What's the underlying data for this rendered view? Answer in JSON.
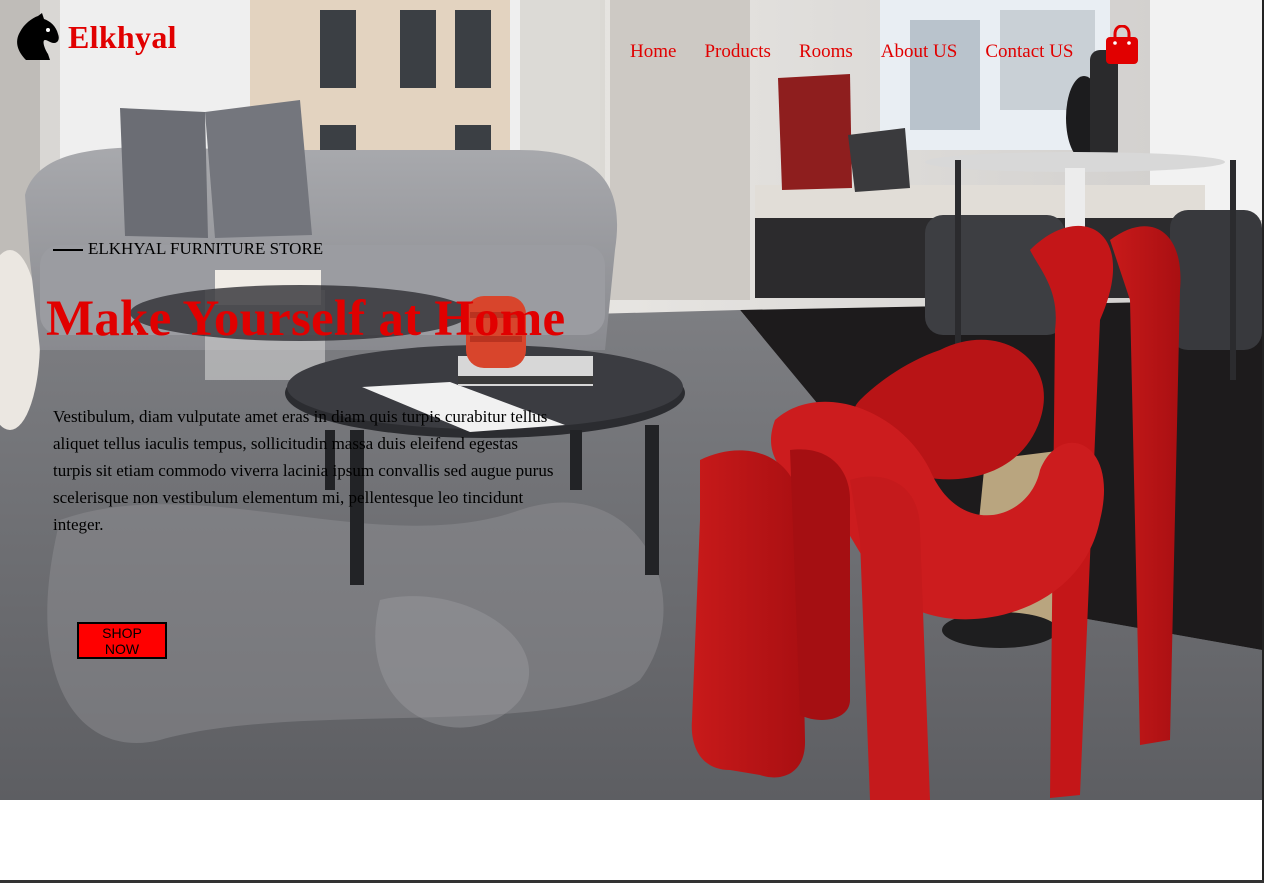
{
  "brand": {
    "name": "Elkhyal",
    "logo_icon": "horse-head-icon",
    "accent": "#e10000"
  },
  "nav": {
    "items": [
      {
        "label": "Home"
      },
      {
        "label": "Products"
      },
      {
        "label": "Rooms"
      },
      {
        "label": "About US"
      },
      {
        "label": "Contact US"
      }
    ],
    "cart_icon": "shopping-bag-icon"
  },
  "hero": {
    "eyebrow": "ELKHYAL FURNITURE STORE",
    "headline": "Make Yourself at Home",
    "description": "Vestibulum, diam vulputate amet eras in diam quis turpis curabitur tellus aliquet tellus iaculis tempus, sollicitudin massa duis eleifend egestas turpis sit etiam commodo viverra lacinia ipsum convallis sed augue purus scelerisque non vestibulum elementum mi, pellentesque leo tincidunt integer.",
    "cta_label": "SHOP NOW",
    "cta_color": "#ff0000"
  }
}
